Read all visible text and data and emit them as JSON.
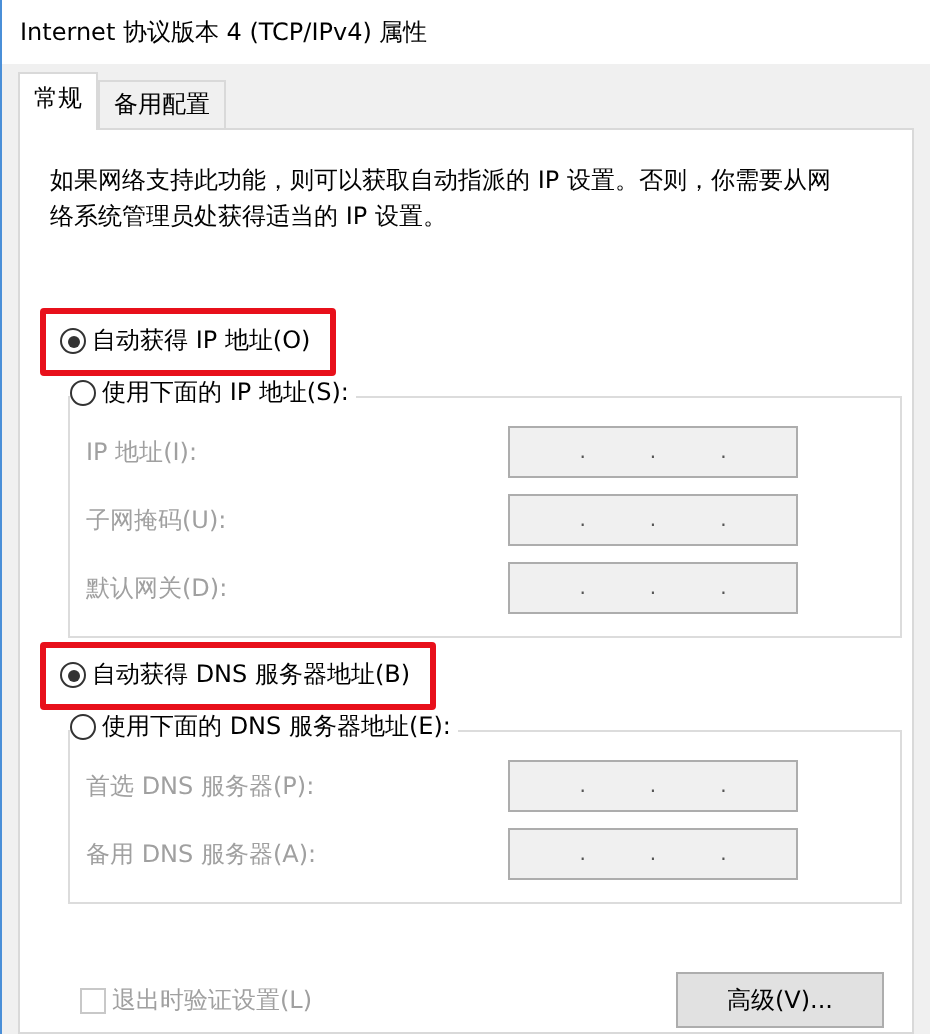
{
  "window": {
    "title": "Internet 协议版本 4 (TCP/IPv4) 属性"
  },
  "tabs": [
    {
      "label": "常规",
      "selected": true
    },
    {
      "label": "备用配置",
      "selected": false
    }
  ],
  "description": "如果网络支持此功能，则可以获取自动指派的 IP 设置。否则，你需要从网络系统管理员处获得适当的 IP 设置。",
  "sections": [
    {
      "auto_option": {
        "label": "自动获得 IP 地址(O)",
        "selected": true,
        "highlighted": true
      },
      "manual_option": {
        "label": "使用下面的 IP 地址(S):",
        "selected": false,
        "highlighted": false
      },
      "fields": [
        {
          "label": "IP 地址(I):",
          "disabled": true,
          "separators": [
            ".",
            ".",
            "."
          ]
        },
        {
          "label": "子网掩码(U):",
          "disabled": true,
          "separators": [
            ".",
            ".",
            "."
          ]
        },
        {
          "label": "默认网关(D):",
          "disabled": true,
          "separators": [
            ".",
            ".",
            "."
          ]
        }
      ]
    },
    {
      "auto_option": {
        "label": "自动获得 DNS 服务器地址(B)",
        "selected": true,
        "highlighted": true
      },
      "manual_option": {
        "label": "使用下面的 DNS 服务器地址(E):",
        "selected": false,
        "highlighted": false
      },
      "fields": [
        {
          "label": "首选 DNS 服务器(P):",
          "disabled": true,
          "separators": [
            ".",
            ".",
            "."
          ]
        },
        {
          "label": "备用 DNS 服务器(A):",
          "disabled": true,
          "separators": [
            ".",
            ".",
            "."
          ]
        }
      ]
    }
  ],
  "validate_checkbox": {
    "label": "退出时验证设置(L)",
    "checked": false,
    "disabled": true
  },
  "advanced_button": {
    "label": "高级(V)..."
  }
}
